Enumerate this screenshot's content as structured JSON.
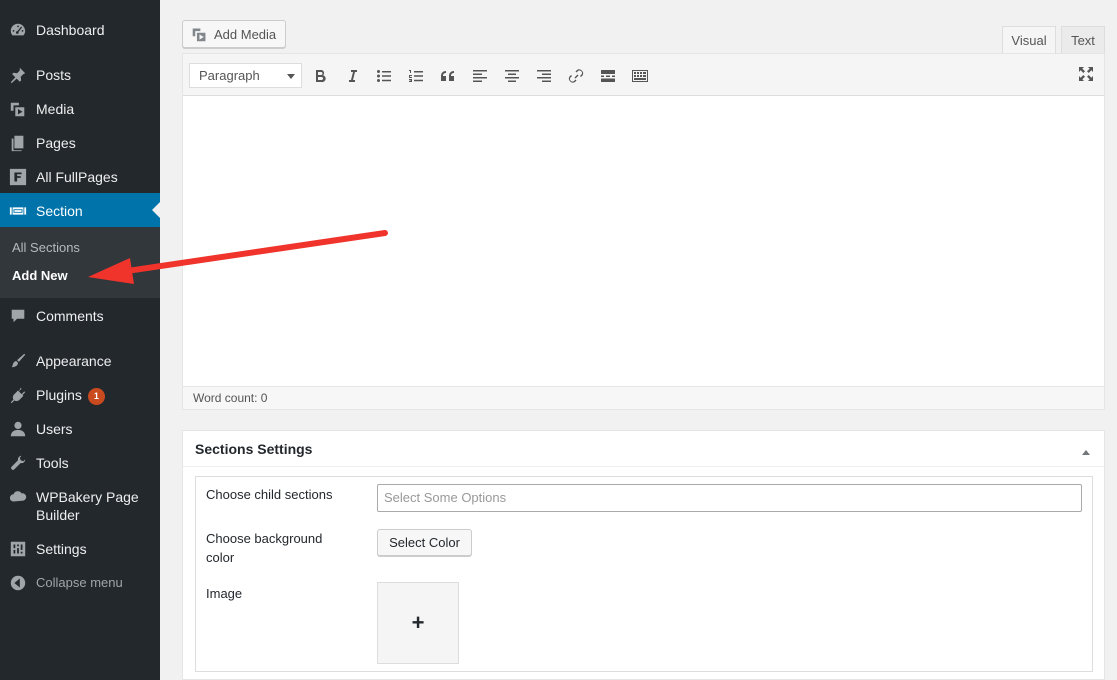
{
  "sidebar": {
    "items": [
      {
        "key": "dashboard",
        "label": "Dashboard",
        "icon": "dashboard-icon"
      },
      {
        "key": "posts",
        "label": "Posts",
        "icon": "pin-icon"
      },
      {
        "key": "media",
        "label": "Media",
        "icon": "media-icon"
      },
      {
        "key": "pages",
        "label": "Pages",
        "icon": "pages-icon"
      },
      {
        "key": "fullpages",
        "label": "All FullPages",
        "icon": "fullpage-logo-icon"
      },
      {
        "key": "section",
        "label": "Section",
        "icon": "section-icon",
        "active": true
      },
      {
        "key": "comments",
        "label": "Comments",
        "icon": "comment-icon"
      },
      {
        "key": "appearance",
        "label": "Appearance",
        "icon": "paintbrush-icon"
      },
      {
        "key": "plugins",
        "label": "Plugins",
        "icon": "plug-icon",
        "badge": "1"
      },
      {
        "key": "users",
        "label": "Users",
        "icon": "user-icon"
      },
      {
        "key": "tools",
        "label": "Tools",
        "icon": "wrench-icon"
      },
      {
        "key": "wpbakery",
        "label": "WPBakery Page Builder",
        "icon": "cloud-icon"
      },
      {
        "key": "settings",
        "label": "Settings",
        "icon": "settings-sliders-icon"
      }
    ],
    "submenu": [
      {
        "label": "All Sections"
      },
      {
        "label": "Add New",
        "current": true
      }
    ],
    "collapse_label": "Collapse menu"
  },
  "editor": {
    "add_media_label": "Add Media",
    "tabs": {
      "visual": "Visual",
      "text": "Text"
    },
    "format_select": "Paragraph",
    "toolbar_icons": [
      "bold-icon",
      "italic-icon",
      "bullet-list-icon",
      "numbered-list-icon",
      "blockquote-icon",
      "align-left-icon",
      "align-center-icon",
      "align-right-icon",
      "link-icon",
      "read-more-icon",
      "toolbar-toggle-icon",
      "fullscreen-icon"
    ],
    "word_count": "Word count: 0"
  },
  "metabox": {
    "title": "Sections Settings",
    "fields": {
      "child_sections_label": "Choose child sections",
      "child_sections_placeholder": "Select Some Options",
      "bg_color_label": "Choose background color",
      "bg_color_button": "Select Color",
      "image_label": "Image",
      "image_add": "+"
    }
  },
  "colors": {
    "sidebar_bg": "#23282d",
    "active_bg": "#0073aa",
    "annotation_arrow": "#f0342c",
    "badge": "#ca4a1f"
  }
}
